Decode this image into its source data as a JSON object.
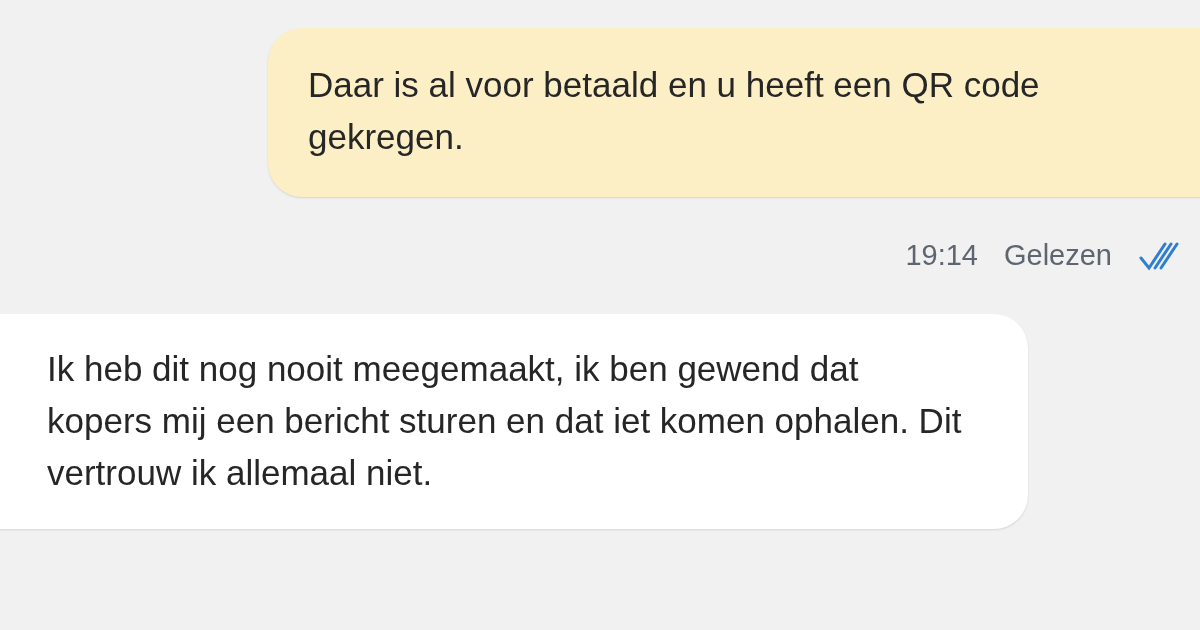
{
  "messages": [
    {
      "kind": "outgoing",
      "text": "Daar is al voor betaald en u heeft een QR code gekregen.",
      "time": "19:14",
      "status": "Gelezen",
      "read": true
    },
    {
      "kind": "incoming",
      "text": "Ik heb dit nog nooit meegemaakt, ik ben gewend dat kopers mij een bericht sturen en dat iet komen ophalen. Dit vertrouw ik allemaal niet."
    }
  ]
}
